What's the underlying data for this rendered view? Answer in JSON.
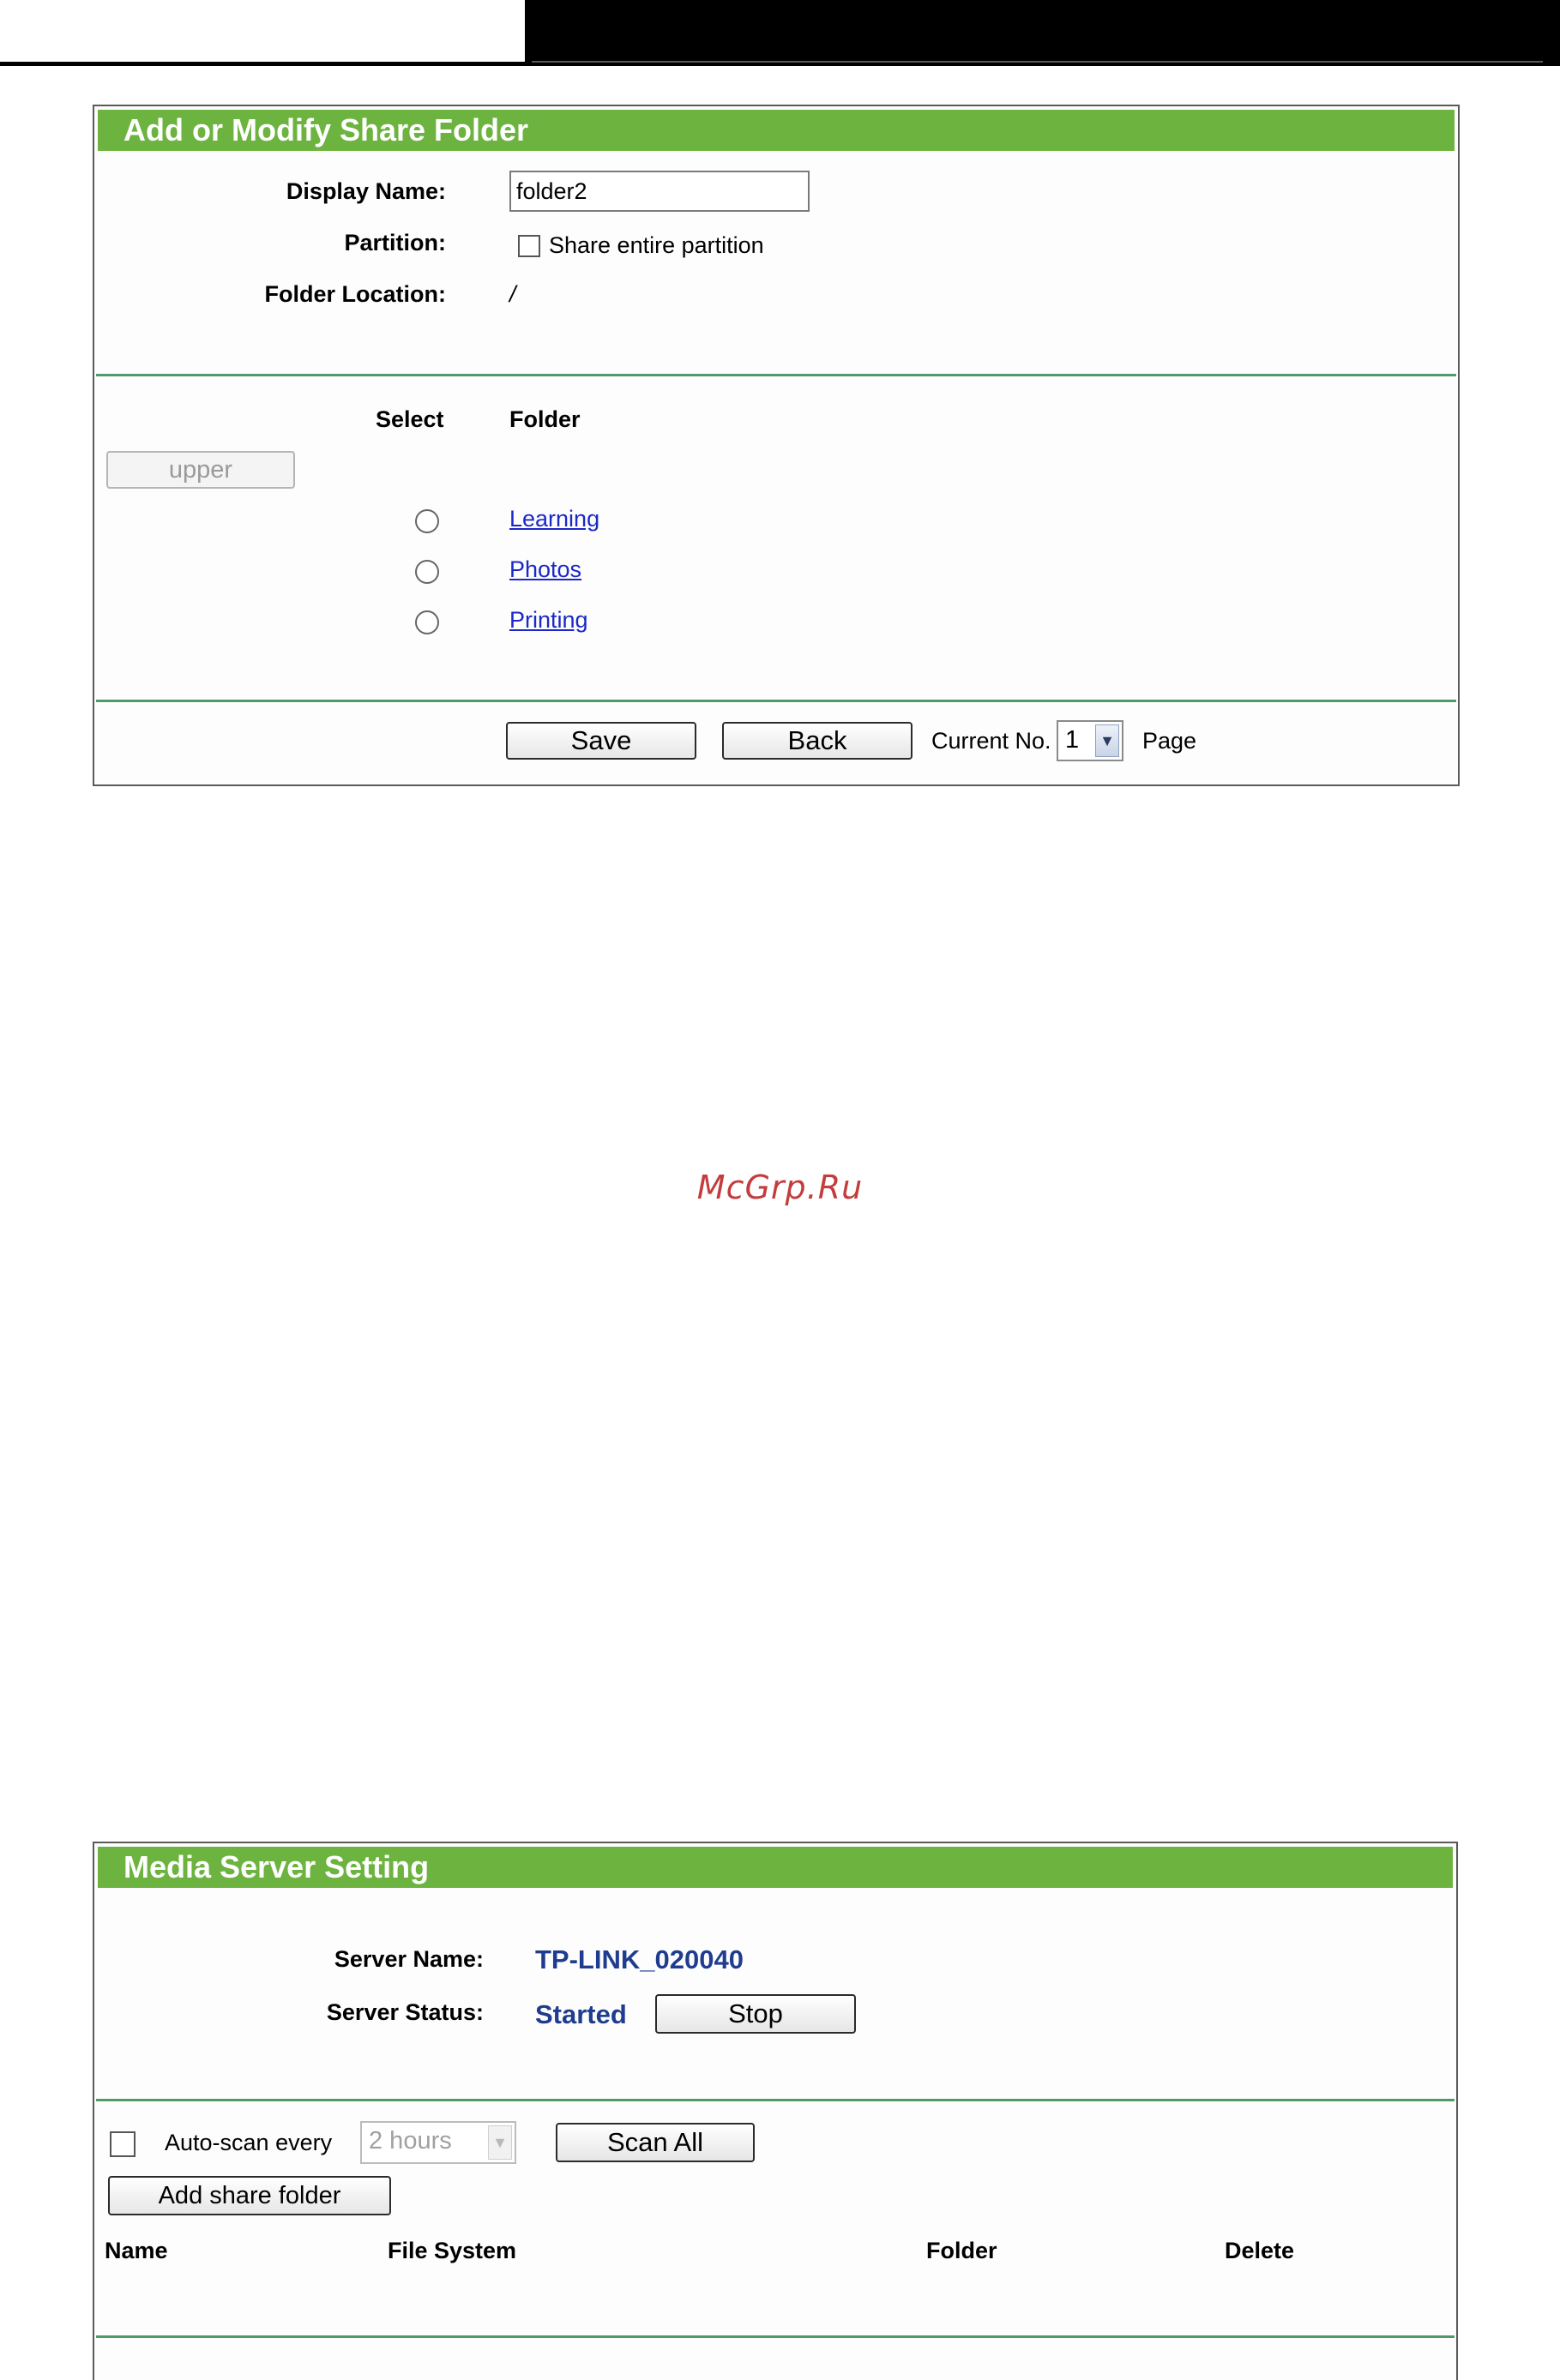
{
  "share_folder_panel": {
    "title": "Add or Modify Share Folder",
    "display_name_label": "Display Name:",
    "display_name_value": "folder2",
    "partition_label": "Partition:",
    "share_entire_partition_label": "Share entire partition",
    "share_entire_partition_checked": false,
    "folder_location_label": "Folder Location:",
    "folder_location_value": "/",
    "select_header": "Select",
    "folder_header": "Folder",
    "upper_button": "upper",
    "folders": [
      "Learning",
      "Photos",
      "Printing"
    ],
    "save_button": "Save",
    "back_button": "Back",
    "current_no_label": "Current No.",
    "current_page_value": "1",
    "page_label": "Page"
  },
  "watermark": "McGrp.Ru",
  "media_server_panel": {
    "title": "Media Server Setting",
    "server_name_label": "Server Name:",
    "server_name_value": "TP-LINK_020040",
    "server_status_label": "Server Status:",
    "server_status_value": "Started",
    "stop_button": "Stop",
    "auto_scan_checked": false,
    "auto_scan_label": "Auto-scan every",
    "auto_scan_interval": "2 hours",
    "scan_all_button": "Scan All",
    "add_share_folder_button": "Add share folder",
    "columns": [
      "Name",
      "File System",
      "Folder",
      "Delete"
    ]
  },
  "colors": {
    "title_bar": "#6db33f",
    "divider": "#4f9a67",
    "link": "#1a28c8",
    "server_value": "#1f3c8f",
    "watermark": "#c43c3c"
  },
  "icons": {
    "dropdown": "chevron-down-icon"
  }
}
